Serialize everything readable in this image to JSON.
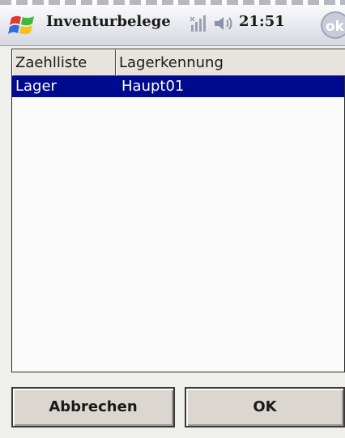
{
  "titlebar": {
    "app_title": "Inventurbelege",
    "clock": "21:51",
    "ok_label": "ok",
    "icons": [
      "windows-start-icon",
      "signal-icon",
      "speaker-icon"
    ]
  },
  "list": {
    "columns": [
      "Zaehlliste",
      "Lagerkennung"
    ],
    "rows": [
      {
        "zaehlliste": "Lager",
        "lagerkennung": "Haupt01",
        "selected": true
      }
    ],
    "selection_color": "#000a8f"
  },
  "buttons": {
    "cancel_label": "Abbrechen",
    "ok_label": "OK"
  }
}
